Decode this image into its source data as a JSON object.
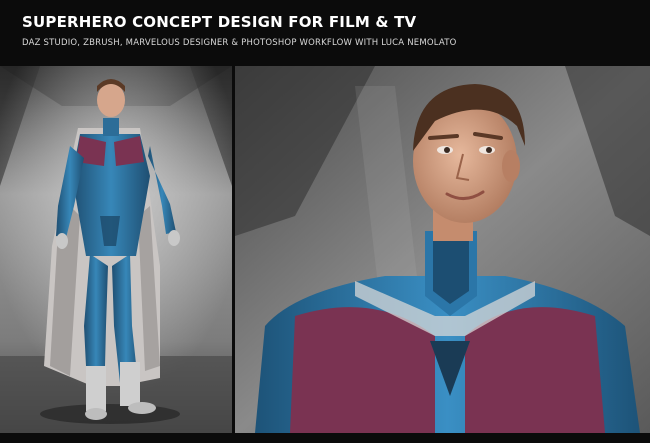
{
  "header": {
    "title": "SUPERHERO CONCEPT DESIGN FOR FILM & TV",
    "subtitle": "DAZ STUDIO, ZBRUSH, MARVELOUS DESIGNER & PHOTOSHOP WORKFLOW WITH LUCA NEMOLATO"
  },
  "colors": {
    "background": "#0b0b0b",
    "suit_blue": "#2f7fae",
    "suit_purple": "#7a3352",
    "cape": "#d8d4d2"
  }
}
